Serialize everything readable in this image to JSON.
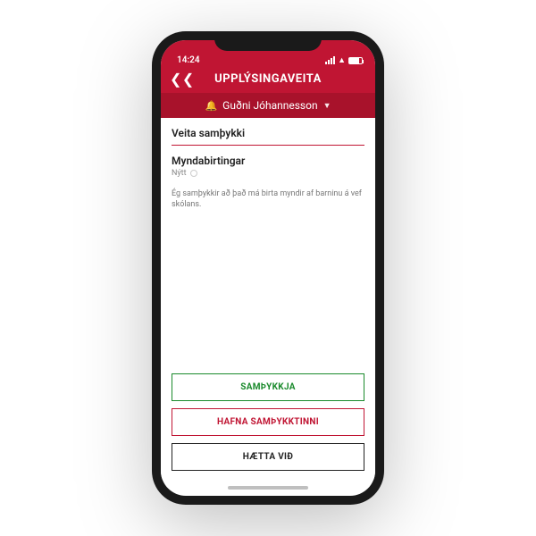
{
  "status": {
    "time": "14:24"
  },
  "header": {
    "title": "UPPLÝSINGAVEITA"
  },
  "user": {
    "name": "Guðni Jóhannesson"
  },
  "section": {
    "title": "Veita samþykki"
  },
  "item": {
    "title": "Myndabirtingar",
    "tag": "Nýtt",
    "description": "Ég samþykkir að það má birta myndir af barninu á vef skólans."
  },
  "buttons": {
    "approve": "SAMÞYKKJA",
    "reject": "HAFNA SAMÞYKKTINNI",
    "cancel": "HÆTTA VIÐ"
  }
}
